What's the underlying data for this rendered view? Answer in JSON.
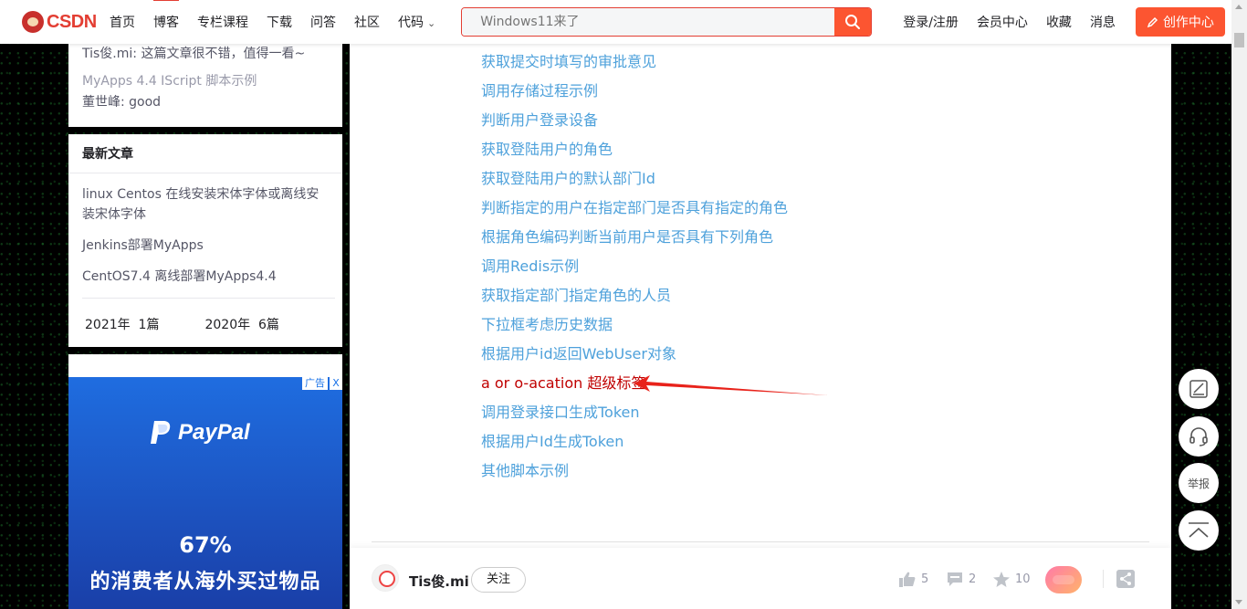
{
  "brand": {
    "logo_text": "CSDN"
  },
  "nav": {
    "items": [
      {
        "label": "首页",
        "active": false
      },
      {
        "label": "博客",
        "active": true
      },
      {
        "label": "专栏课程",
        "active": false
      },
      {
        "label": "下载",
        "active": false
      },
      {
        "label": "问答",
        "active": false
      },
      {
        "label": "社区",
        "active": false
      },
      {
        "label": "代码",
        "active": false
      }
    ],
    "search_placeholder": "Windows11来了",
    "right_links": [
      "登录/注册",
      "会员中心",
      "收藏",
      "消息"
    ],
    "create_label": "创作中心"
  },
  "sidebar": {
    "comments": [
      {
        "text": "Tis俊.mi: 这篇文章很不错，值得一看~"
      },
      {
        "text": "MyApps 4.4 IScript 脚本示例"
      },
      {
        "text": "董世峰: good"
      }
    ],
    "latest": {
      "title": "最新文章",
      "items": [
        "linux Centos 在线安装宋体字体或离线安装宋体字体",
        "Jenkins部署MyApps",
        "CentOS7.4 离线部署MyApps4.4"
      ],
      "archive": [
        {
          "year": "2021年",
          "count": "1篇"
        },
        {
          "year": "2020年",
          "count": "6篇"
        }
      ]
    }
  },
  "ad": {
    "tag": "广告",
    "close": "X",
    "brand": "PayPal",
    "headline": "67%",
    "subline": "的消费者从海外买过物品"
  },
  "article": {
    "links": [
      {
        "label": "获取提交时填写的审批意见",
        "highlight": false
      },
      {
        "label": "调用存储过程示例",
        "highlight": false
      },
      {
        "label": "判断用户登录设备",
        "highlight": false
      },
      {
        "label": "获取登陆用户的角色",
        "highlight": false
      },
      {
        "label": "获取登陆用户的默认部门Id",
        "highlight": false
      },
      {
        "label": "判断指定的用户在指定部门是否具有指定的角色",
        "highlight": false
      },
      {
        "label": "根据角色编码判断当前用户是否具有下列角色",
        "highlight": false
      },
      {
        "label": "调用Redis示例",
        "highlight": false
      },
      {
        "label": "获取指定部门指定角色的人员",
        "highlight": false
      },
      {
        "label": "下拉框考虑历史数据",
        "highlight": false
      },
      {
        "label": "根据用户id返回WebUser对象",
        "highlight": false
      },
      {
        "label": "a or o-acation 超级标签",
        "highlight": true
      },
      {
        "label": "调用登录接口生成Token",
        "highlight": false
      },
      {
        "label": "根据用户Id生成Token",
        "highlight": false
      },
      {
        "label": "其他脚本示例",
        "highlight": false
      }
    ],
    "author": {
      "name": "Tis俊.mi",
      "follow_label": "关注"
    },
    "stats": {
      "likes": "5",
      "comments": "2",
      "favorites": "10"
    }
  },
  "float_buttons": {
    "report_label": "举报"
  },
  "colors": {
    "brand_red": "#fc5531",
    "link_blue": "#4ea1db",
    "highlight_red": "#c00000"
  }
}
